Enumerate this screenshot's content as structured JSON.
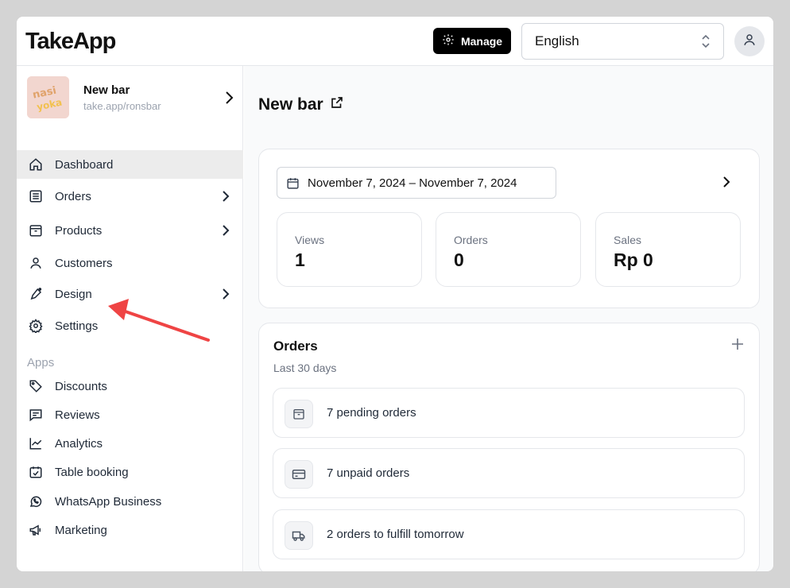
{
  "header": {
    "logo": "TakeApp",
    "manage_label": "Manage",
    "language": "English"
  },
  "store": {
    "name": "New bar",
    "url": "take.app/ronsbar",
    "thumb_text": "nasi yoka"
  },
  "sidebar": {
    "items": [
      {
        "label": "Dashboard",
        "icon": "home-icon",
        "active": true
      },
      {
        "label": "Orders",
        "icon": "list-icon"
      },
      {
        "label": "Products",
        "icon": "box-icon"
      },
      {
        "label": "Customers",
        "icon": "user-icon"
      },
      {
        "label": "Design",
        "icon": "pen-icon"
      },
      {
        "label": "Settings",
        "icon": "gear-icon"
      }
    ],
    "apps_header": "Apps",
    "apps": [
      {
        "label": "Discounts",
        "icon": "tag-icon"
      },
      {
        "label": "Reviews",
        "icon": "message-icon"
      },
      {
        "label": "Analytics",
        "icon": "chart-line-icon"
      },
      {
        "label": "Table booking",
        "icon": "calendar-check-icon"
      },
      {
        "label": "WhatsApp Business",
        "icon": "whatsapp-icon"
      },
      {
        "label": "Marketing",
        "icon": "megaphone-icon"
      }
    ]
  },
  "main": {
    "title": "New bar",
    "date_range": "November 7, 2024 – November 7, 2024",
    "stats": [
      {
        "label": "Views",
        "value": "1"
      },
      {
        "label": "Orders",
        "value": "0"
      },
      {
        "label": "Sales",
        "value": "Rp 0"
      }
    ],
    "orders": {
      "title": "Orders",
      "subtitle": "Last 30 days",
      "rows": [
        {
          "label": "7 pending orders",
          "icon": "box-icon"
        },
        {
          "label": "7 unpaid orders",
          "icon": "credit-card-icon"
        },
        {
          "label": "2 orders to fulfill tomorrow",
          "icon": "truck-icon"
        }
      ]
    }
  },
  "colors": {
    "annotation_arrow": "#ef4444",
    "manage_bg": "#000000",
    "active_bg": "#ececec"
  }
}
